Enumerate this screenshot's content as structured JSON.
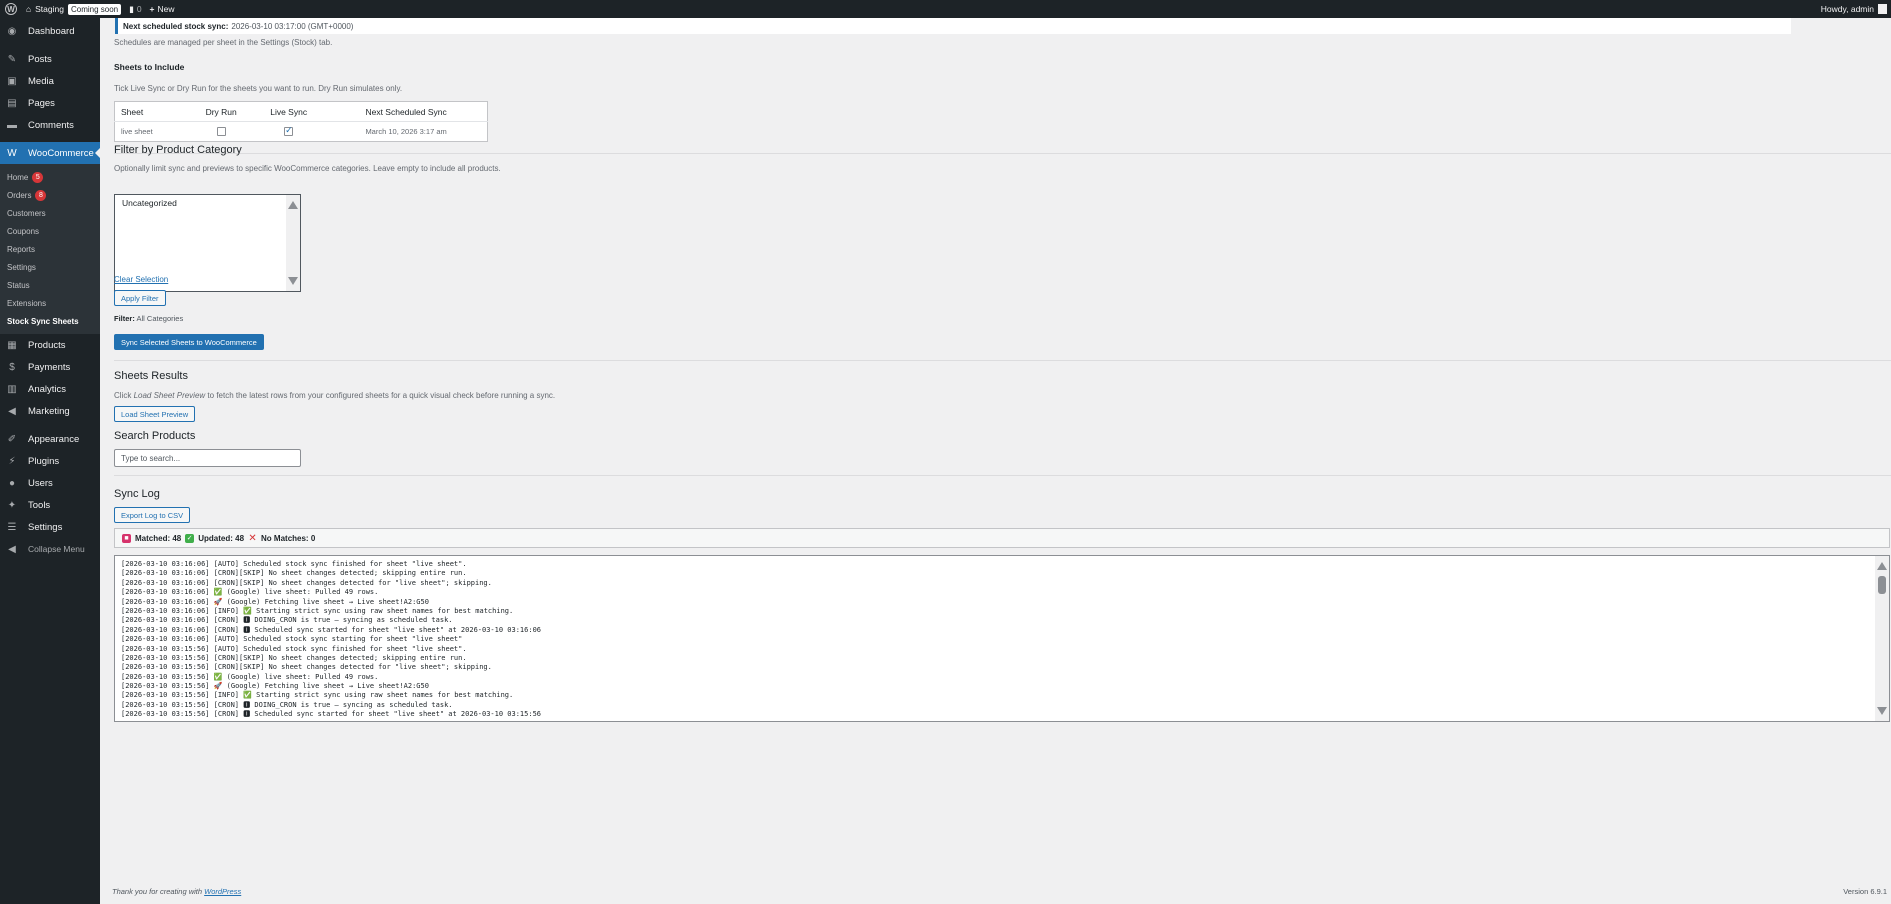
{
  "adminbar": {
    "site_name": "Staging",
    "coming_soon": "Coming soon",
    "comments_count": "0",
    "new_label": "New",
    "howdy": "Howdy, admin"
  },
  "sidebar": {
    "dashboard": "Dashboard",
    "posts": "Posts",
    "media": "Media",
    "pages": "Pages",
    "comments": "Comments",
    "woocommerce": "WooCommerce",
    "submenu": {
      "home": "Home",
      "home_badge": "5",
      "orders": "Orders",
      "orders_badge": "8",
      "customers": "Customers",
      "coupons": "Coupons",
      "reports": "Reports",
      "settings": "Settings",
      "status": "Status",
      "extensions": "Extensions",
      "stock_sync": "Stock Sync Sheets"
    },
    "products": "Products",
    "payments": "Payments",
    "analytics": "Analytics",
    "marketing": "Marketing",
    "appearance": "Appearance",
    "plugins": "Plugins",
    "users": "Users",
    "tools": "Tools",
    "settings": "Settings",
    "collapse": "Collapse Menu"
  },
  "main": {
    "next_sync_label": "Next scheduled stock sync:",
    "next_sync_value": "2026-03-10 03:17:00 (GMT+0000)",
    "schedules_note": "Schedules are managed per sheet in the Settings (Stock) tab.",
    "sheets_heading": "Sheets to Include",
    "sheets_desc": "Tick Live Sync or Dry Run for the sheets you want to run. Dry Run simulates only.",
    "table": {
      "headers": [
        "Sheet",
        "Dry Run",
        "Live Sync",
        "Next Scheduled Sync"
      ],
      "rows": [
        {
          "sheet": "live sheet",
          "dry_run": false,
          "live_sync": true,
          "next": "March 10, 2026 3:17 am"
        }
      ]
    },
    "filter_heading": "Filter by Product Category",
    "filter_desc": "Optionally limit sync and previews to specific WooCommerce categories. Leave empty to include all products.",
    "categories": [
      "Uncategorized"
    ],
    "clear_selection": "Clear Selection",
    "apply_filter": "Apply Filter",
    "filter_status_label": "Filter:",
    "filter_status_value": "All Categories",
    "sync_button": "Sync Selected Sheets to WooCommerce",
    "results_heading": "Sheets Results",
    "results_desc_pre": "Click",
    "results_desc_em": "Load Sheet Preview",
    "results_desc_post": "to fetch the latest rows from your configured sheets for a quick visual check before running a sync.",
    "load_preview": "Load Sheet Preview",
    "search_heading": "Search Products",
    "search_placeholder": "Type to search...",
    "log_heading": "Sync Log",
    "export_log": "Export Log to CSV",
    "stats": {
      "matched": "Matched: 48",
      "updated": "Updated: 48",
      "no_matches": "No Matches: 0"
    },
    "log_lines": [
      "[2026-03-10 03:16:06] [AUTO] Scheduled stock sync finished for sheet \"live sheet\".",
      "[2026-03-10 03:16:06] [CRON][SKIP] No sheet changes detected; skipping entire run.",
      "[2026-03-10 03:16:06] [CRON][SKIP] No sheet changes detected for \"live sheet\"; skipping.",
      "[2026-03-10 03:16:06] ✅ (Google) live sheet: Pulled 49 rows.",
      "[2026-03-10 03:16:06] 🚀 (Google) Fetching live sheet → Live sheet!A2:G50",
      "[2026-03-10 03:16:06] [INFO] ✅ Starting strict sync using raw sheet names for best matching.",
      "[2026-03-10 03:16:06] [CRON] 🅸 DOING_CRON is true – syncing as scheduled task.",
      "[2026-03-10 03:16:06] [CRON] 🅸 Scheduled sync started for sheet \"live sheet\" at 2026-03-10 03:16:06",
      "[2026-03-10 03:16:06] [AUTO] Scheduled stock sync starting for sheet \"live sheet\"",
      "[2026-03-10 03:15:56] [AUTO] Scheduled stock sync finished for sheet \"live sheet\".",
      "[2026-03-10 03:15:56] [CRON][SKIP] No sheet changes detected; skipping entire run.",
      "[2026-03-10 03:15:56] [CRON][SKIP] No sheet changes detected for \"live sheet\"; skipping.",
      "[2026-03-10 03:15:56] ✅ (Google) live sheet: Pulled 49 rows.",
      "[2026-03-10 03:15:56] 🚀 (Google) Fetching live sheet → Live sheet!A2:G50",
      "[2026-03-10 03:15:56] [INFO] ✅ Starting strict sync using raw sheet names for best matching.",
      "[2026-03-10 03:15:56] [CRON] 🅸 DOING_CRON is true – syncing as scheduled task.",
      "[2026-03-10 03:15:56] [CRON] 🅸 Scheduled sync started for sheet \"live sheet\" at 2026-03-10 03:15:56"
    ],
    "footer_thanks": "Thank you for creating with",
    "footer_link": "WordPress",
    "version": "Version 6.9.1"
  }
}
